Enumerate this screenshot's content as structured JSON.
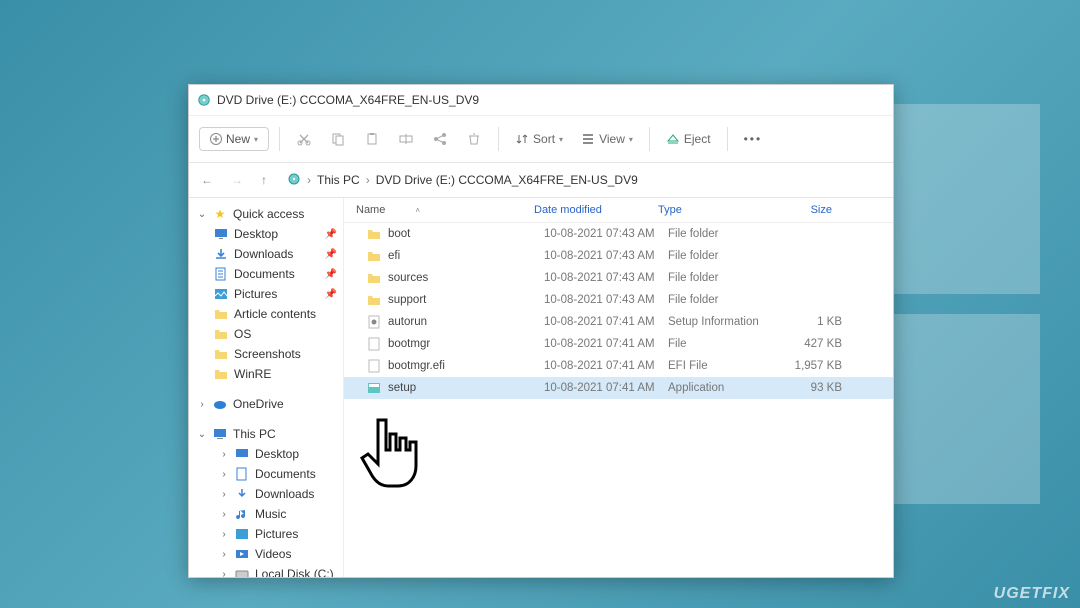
{
  "window": {
    "title": "DVD Drive (E:) CCCOMA_X64FRE_EN-US_DV9"
  },
  "toolbar": {
    "new_label": "New",
    "sort_label": "Sort",
    "view_label": "View",
    "eject_label": "Eject"
  },
  "breadcrumb": {
    "loc1": "This PC",
    "loc2": "DVD Drive (E:) CCCOMA_X64FRE_EN-US_DV9"
  },
  "columns": {
    "name": "Name",
    "date": "Date modified",
    "type": "Type",
    "size": "Size"
  },
  "sidebar": {
    "quick_access": "Quick access",
    "desktop": "Desktop",
    "downloads": "Downloads",
    "documents": "Documents",
    "pictures": "Pictures",
    "article_contents": "Article contents",
    "os": "OS",
    "screenshots": "Screenshots",
    "winre": "WinRE",
    "onedrive": "OneDrive",
    "this_pc": "This PC",
    "pc_desktop": "Desktop",
    "pc_documents": "Documents",
    "pc_downloads": "Downloads",
    "pc_music": "Music",
    "pc_pictures": "Pictures",
    "pc_videos": "Videos",
    "pc_localdisk": "Local Disk (C:)"
  },
  "files": [
    {
      "name": "boot",
      "date": "10-08-2021 07:43 AM",
      "type": "File folder",
      "size": "",
      "icon": "folder"
    },
    {
      "name": "efi",
      "date": "10-08-2021 07:43 AM",
      "type": "File folder",
      "size": "",
      "icon": "folder"
    },
    {
      "name": "sources",
      "date": "10-08-2021 07:43 AM",
      "type": "File folder",
      "size": "",
      "icon": "folder"
    },
    {
      "name": "support",
      "date": "10-08-2021 07:43 AM",
      "type": "File folder",
      "size": "",
      "icon": "folder"
    },
    {
      "name": "autorun",
      "date": "10-08-2021 07:41 AM",
      "type": "Setup Information",
      "size": "1 KB",
      "icon": "inf"
    },
    {
      "name": "bootmgr",
      "date": "10-08-2021 07:41 AM",
      "type": "File",
      "size": "427 KB",
      "icon": "file"
    },
    {
      "name": "bootmgr.efi",
      "date": "10-08-2021 07:41 AM",
      "type": "EFI File",
      "size": "1,957 KB",
      "icon": "file"
    },
    {
      "name": "setup",
      "date": "10-08-2021 07:41 AM",
      "type": "Application",
      "size": "93 KB",
      "icon": "app",
      "selected": true
    }
  ],
  "watermark": "UGETFIX"
}
